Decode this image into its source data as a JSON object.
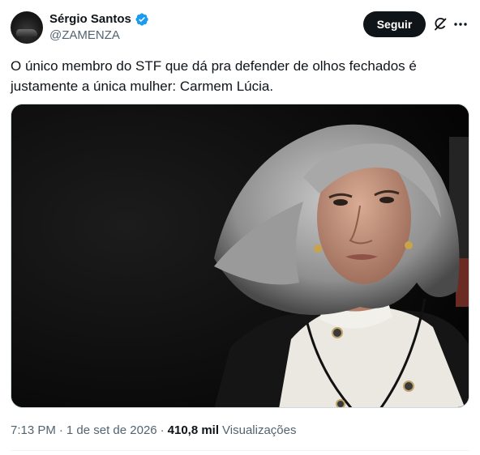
{
  "author": {
    "name": "Sérgio Santos",
    "handle": "@ZAMENZA",
    "verified": true
  },
  "header": {
    "follow_label": "Seguir",
    "icons": [
      "grok-icon",
      "more-icon"
    ]
  },
  "tweet": {
    "text": "O único membro do STF que dá pra defender de olhos fechados é justamente a única mulher: Carmem Lúcia."
  },
  "meta": {
    "time": "7:13 PM",
    "separator": "·",
    "date": "1 de set de 2026",
    "views_count": "410,8 mil",
    "views_label": "Visualizações"
  },
  "colors": {
    "verified_badge": "#1d9bf0",
    "follow_button_bg": "#0f1419",
    "secondary_text": "#536471"
  }
}
